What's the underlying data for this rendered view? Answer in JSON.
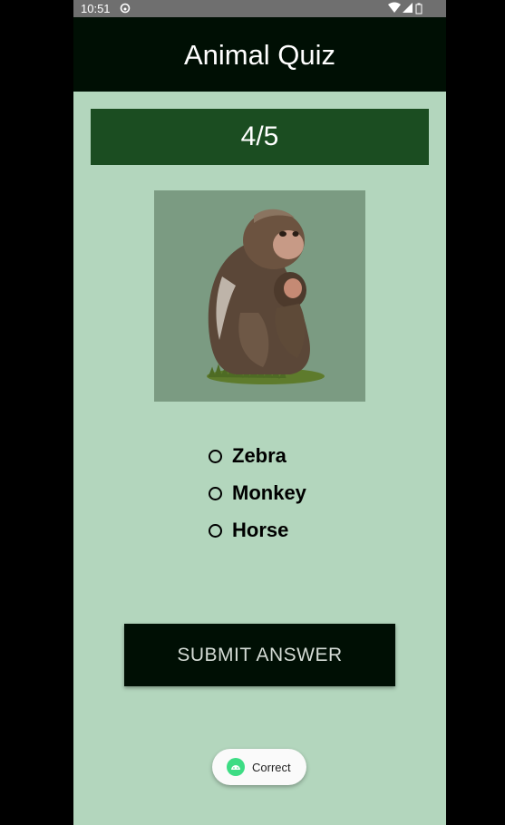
{
  "status_bar": {
    "time": "10:51",
    "icons": [
      "app-notification-icon",
      "wifi-icon",
      "signal-icon",
      "battery-icon"
    ]
  },
  "app_bar": {
    "title": "Animal Quiz"
  },
  "quiz": {
    "progress": "4/5",
    "image": {
      "subject": "monkey-with-baby",
      "background": "#7b9b82"
    },
    "options": [
      {
        "label": "Zebra",
        "selected": false
      },
      {
        "label": "Monkey",
        "selected": false
      },
      {
        "label": "Horse",
        "selected": false
      }
    ],
    "submit_label": "SUBMIT ANSWER"
  },
  "toast": {
    "text": "Correct",
    "icon": "android-icon"
  },
  "colors": {
    "screen_bg": "#b3d6bd",
    "app_bar_bg": "#000f04",
    "progress_bg": "#1b4d21",
    "image_bg": "#7b9b82",
    "button_bg": "#000f04",
    "button_text": "#d5dcd6"
  }
}
